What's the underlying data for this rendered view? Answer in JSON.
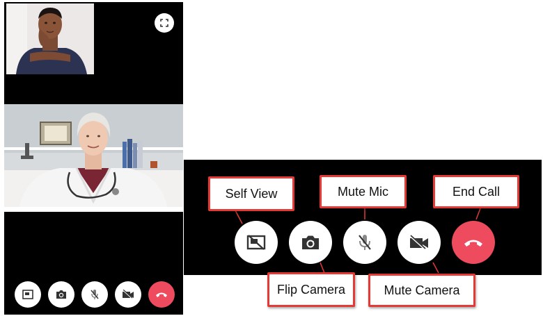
{
  "callouts": {
    "self_view": "Self View",
    "mute_mic": "Mute Mic",
    "end_call": "End Call",
    "flip_camera": "Flip Camera",
    "mute_camera": "Mute Camera"
  },
  "icons": {
    "self_view_toggle": "picture-in-picture-off-icon",
    "flip_camera": "camera-flip-icon",
    "mute_mic": "mic-off-icon",
    "mute_camera": "video-off-icon",
    "end_call": "phone-hangup-icon",
    "expand": "fullscreen-icon"
  },
  "colors": {
    "end_call": "#ee4b5f",
    "callout_border": "#e53935",
    "background": "#000000"
  }
}
